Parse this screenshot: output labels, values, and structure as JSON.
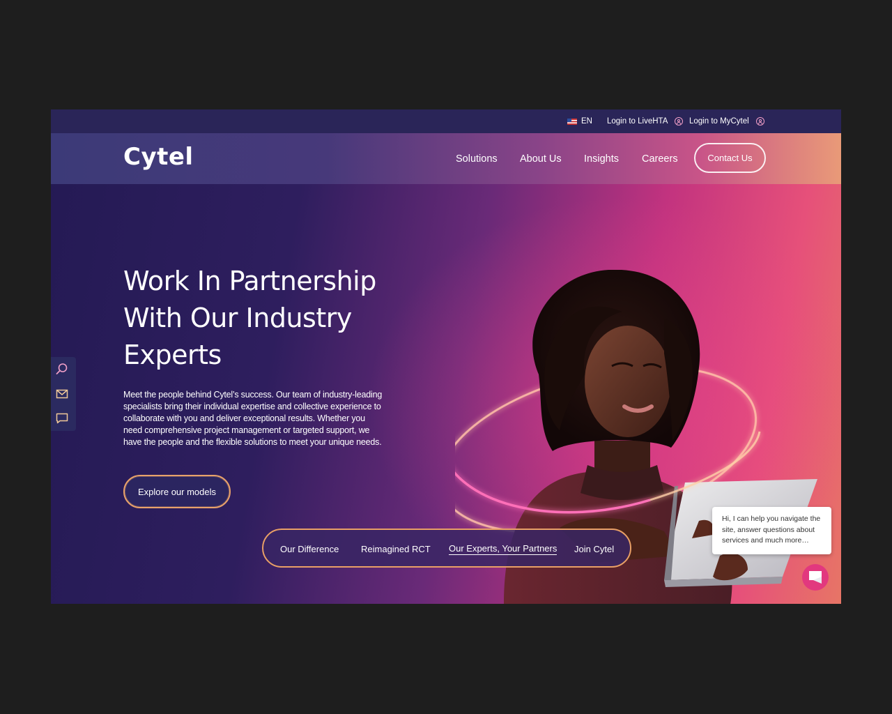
{
  "utility_bar": {
    "language": "EN",
    "login_livehta": "Login to LiveHTA",
    "login_mycytel": "Login to MyCytel"
  },
  "nav": {
    "logo": "Cytel",
    "items": [
      {
        "label": "Solutions"
      },
      {
        "label": "About Us"
      },
      {
        "label": "Insights"
      },
      {
        "label": "Careers"
      }
    ],
    "contact_label": "Contact Us"
  },
  "hero": {
    "title_lines": [
      "Work In Partnership",
      "With Our Industry",
      "Experts"
    ],
    "description": "Meet the people behind Cytel’s success. Our team of industry-leading specialists bring their individual expertise and collective experience to collaborate with you and deliver exceptional results. Whether you need comprehensive project management or targeted support, we have the people and the flexible solutions to meet your unique needs.",
    "cta_label": "Explore our models"
  },
  "sidebar": {
    "icons": [
      "search-icon",
      "mail-icon",
      "chat-icon"
    ]
  },
  "subtabs": [
    {
      "label": "Our Difference",
      "active": false
    },
    {
      "label": "Reimagined RCT",
      "active": false
    },
    {
      "label": "Our Experts, Your Partners",
      "active": true
    },
    {
      "label": "Join Cytel",
      "active": false
    }
  ],
  "chat": {
    "message": "Hi, I can help you navigate the site, answer questions about services and much more…"
  },
  "colors": {
    "accent_orange": "#e9a066",
    "brand_pink": "#e2387e",
    "navy": "#2a2558"
  }
}
